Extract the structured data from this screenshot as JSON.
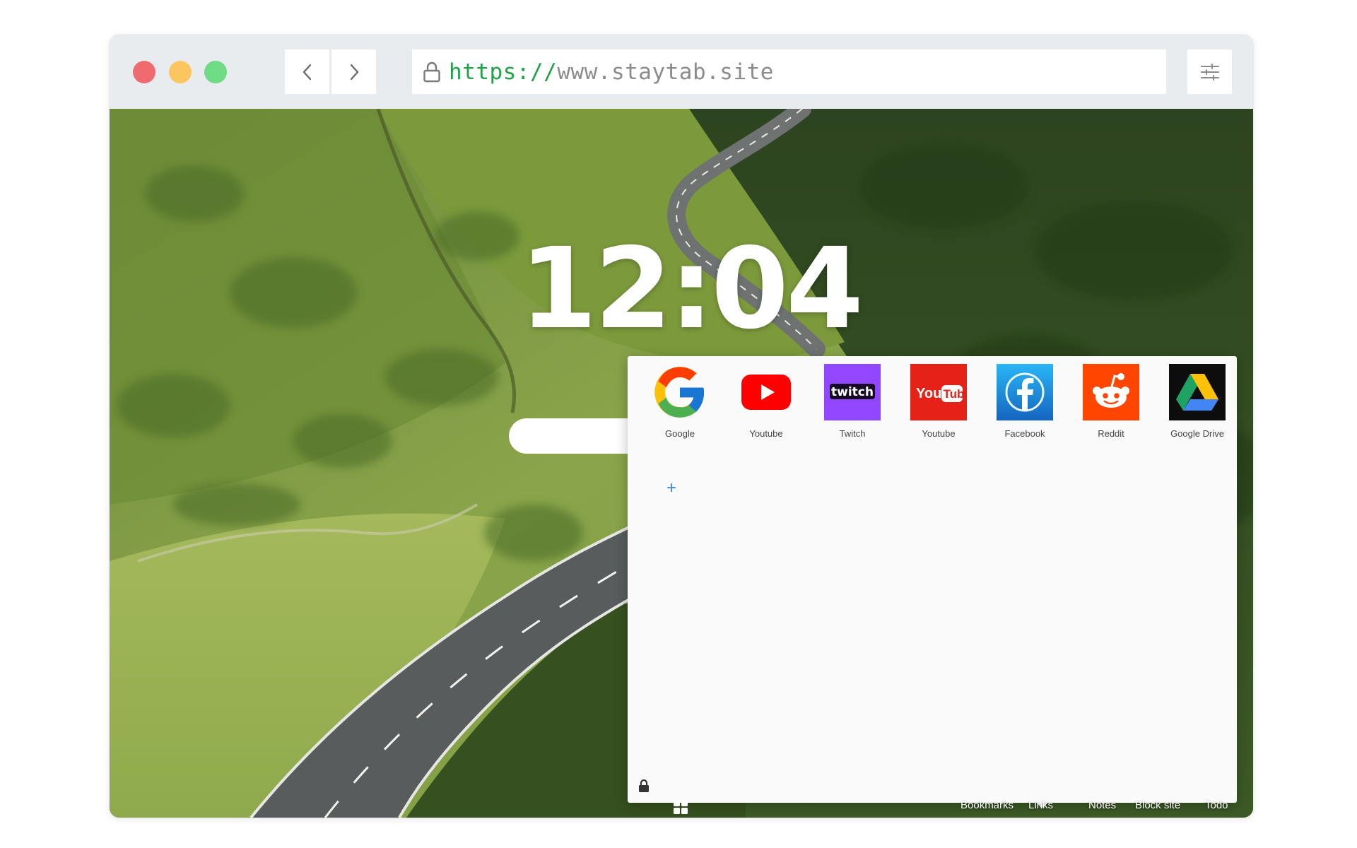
{
  "browser": {
    "url_scheme": "https://",
    "url_host": "www.staytab.site",
    "controls": {
      "back_icon": "chevron-left-icon",
      "forward_icon": "chevron-right-icon",
      "menu_icon": "sliders-icon"
    }
  },
  "clock": {
    "time": "12:04"
  },
  "links": [
    {
      "label": "Google",
      "icon": "google-icon"
    },
    {
      "label": "Youtube",
      "icon": "youtube-play-icon"
    },
    {
      "label": "Twitch",
      "icon": "twitch-icon"
    },
    {
      "label": "Youtube",
      "icon": "youtube-logo-icon"
    },
    {
      "label": "Facebook",
      "icon": "facebook-icon"
    },
    {
      "label": "Reddit",
      "icon": "reddit-icon"
    },
    {
      "label": "Google Drive",
      "icon": "google-drive-icon"
    }
  ],
  "add_link": {
    "symbol": "+"
  },
  "bottom_nav": [
    {
      "label": "Bookmarks"
    },
    {
      "label": "Links",
      "active": true
    },
    {
      "label": "Notes"
    },
    {
      "label": "Block site"
    },
    {
      "label": "Todo"
    }
  ],
  "colors": {
    "url_scheme": "#1fa34a",
    "url_host": "#8c8c8c",
    "traffic_red": "#f06b6f",
    "traffic_yellow": "#fbc660",
    "traffic_green": "#6fdb84",
    "accent": "#3b82f6"
  }
}
